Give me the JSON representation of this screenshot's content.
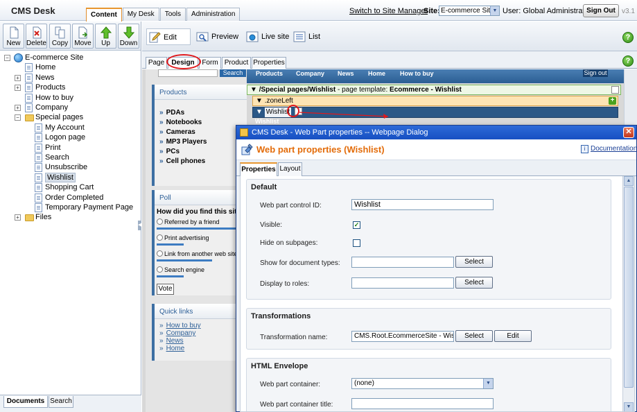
{
  "app": {
    "logo": "CMS Desk",
    "version": "v3.1",
    "main_tabs": [
      {
        "label": "Content",
        "active": true
      },
      {
        "label": "My Desk",
        "active": false
      },
      {
        "label": "Tools",
        "active": false
      },
      {
        "label": "Administration",
        "active": false
      }
    ],
    "switch_link": "Switch to Site Manager",
    "site_label": "Site:",
    "site_value": "E-commerce Site",
    "user_label": "User: Global Administrator",
    "signout_label": "Sign Out"
  },
  "left_toolbar": {
    "buttons": [
      {
        "label": "New",
        "icon": "new-document-icon"
      },
      {
        "label": "Delete",
        "icon": "delete-icon"
      },
      {
        "label": "Copy",
        "icon": "copy-icon"
      },
      {
        "label": "Move",
        "icon": "move-icon"
      },
      {
        "label": "Up",
        "icon": "arrow-up-icon"
      },
      {
        "label": "Down",
        "icon": "arrow-down-icon"
      }
    ]
  },
  "tree": {
    "root": "E-commerce Site",
    "items": [
      {
        "label": "Home",
        "level": 1,
        "expander": false,
        "type": "page"
      },
      {
        "label": "News",
        "level": 1,
        "expander": "+",
        "type": "page"
      },
      {
        "label": "Products",
        "level": 1,
        "expander": "+",
        "type": "page"
      },
      {
        "label": "How to buy",
        "level": 1,
        "expander": false,
        "type": "page"
      },
      {
        "label": "Company",
        "level": 1,
        "expander": "+",
        "type": "page"
      },
      {
        "label": "Special pages",
        "level": 1,
        "expander": "-",
        "type": "folder"
      },
      {
        "label": "My Account",
        "level": 2,
        "expander": false,
        "type": "page"
      },
      {
        "label": "Logon page",
        "level": 2,
        "expander": false,
        "type": "page"
      },
      {
        "label": "Print",
        "level": 2,
        "expander": false,
        "type": "page"
      },
      {
        "label": "Search",
        "level": 2,
        "expander": false,
        "type": "page"
      },
      {
        "label": "Unsubscribe",
        "level": 2,
        "expander": false,
        "type": "page"
      },
      {
        "label": "Wishlist",
        "level": 2,
        "expander": false,
        "type": "page",
        "selected": true
      },
      {
        "label": "Shopping Cart",
        "level": 2,
        "expander": false,
        "type": "page"
      },
      {
        "label": "Order Completed",
        "level": 2,
        "expander": false,
        "type": "page"
      },
      {
        "label": "Temporary Payment Page",
        "level": 2,
        "expander": false,
        "type": "page"
      },
      {
        "label": "Files",
        "level": 1,
        "expander": "+",
        "type": "folder"
      }
    ]
  },
  "bottom_tabs": [
    {
      "label": "Documents",
      "active": true
    },
    {
      "label": "Search",
      "active": false
    }
  ],
  "right_toolbar": {
    "buttons": [
      {
        "label": "Edit",
        "icon": "edit-icon",
        "active": true
      },
      {
        "label": "Preview",
        "icon": "preview-icon",
        "active": false
      },
      {
        "label": "Live site",
        "icon": "live-site-icon",
        "active": false
      },
      {
        "label": "List",
        "icon": "list-icon",
        "active": false
      }
    ]
  },
  "sub_tabs": [
    {
      "label": "Page",
      "active": false
    },
    {
      "label": "Design",
      "active": true
    },
    {
      "label": "Form",
      "active": false
    },
    {
      "label": "Product",
      "active": false
    },
    {
      "label": "Properties",
      "active": false
    }
  ],
  "preview": {
    "search_button": "Search",
    "top_nav": [
      "Products",
      "Company",
      "News",
      "Home",
      "How to buy"
    ],
    "signout": "Sign out",
    "products_title": "Products",
    "products": [
      "PDAs",
      "Notebooks",
      "Cameras",
      "MP3 Players",
      "PCs",
      "Cell phones"
    ],
    "poll_title": "Poll",
    "poll_question": "How did you find this site?",
    "poll_options": [
      {
        "label": "Referred by a friend",
        "share": 1.0
      },
      {
        "label": "Print advertising",
        "share": 0.31
      },
      {
        "label": "Link from another web site",
        "share": 0.64
      },
      {
        "label": "Search engine",
        "share": 0.31
      }
    ],
    "vote_label": "Vote",
    "quick_links_title": "Quick links",
    "quick_links": [
      "How to buy",
      "Company",
      "News",
      "Home"
    ],
    "template_bar_prefix": "/Special pages/Wishlist",
    "template_bar_middle": " - page template: ",
    "template_bar_name": "Ecommerce - Wishlist",
    "zone_label": ".zoneLeft",
    "webpart_label": "Wishlist",
    "webpart_caption": "Wishlist"
  },
  "dialog": {
    "title": "CMS Desk - Web Part properties -- Webpage Dialog",
    "heading": "Web part properties (Wishlist)",
    "documentation_link": "Documentation",
    "tabs": [
      {
        "label": "Properties",
        "active": true
      },
      {
        "label": "Layout",
        "active": false
      }
    ],
    "sections": {
      "default": {
        "title": "Default",
        "control_id_label": "Web part control ID:",
        "control_id_value": "Wishlist",
        "visible_label": "Visible:",
        "visible_checked": true,
        "hide_label": "Hide on subpages:",
        "hide_checked": false,
        "doc_types_label": "Show for document types:",
        "doc_types_value": "",
        "roles_label": "Display to roles:",
        "roles_value": "",
        "select_label": "Select"
      },
      "transformations": {
        "title": "Transformations",
        "name_label": "Transformation name:",
        "name_value": "CMS.Root.EcommerceSite - Wishlist",
        "select_label": "Select",
        "edit_label": "Edit"
      },
      "envelope": {
        "title": "HTML Envelope",
        "container_label": "Web part container:",
        "container_value": "(none)",
        "container_title_label": "Web part container title:",
        "container_title_value": ""
      }
    }
  },
  "colors": {
    "accent_orange": "#e36c0a",
    "highlight_red": "#e1181b",
    "dialog_title_blue": "#1750c2"
  }
}
